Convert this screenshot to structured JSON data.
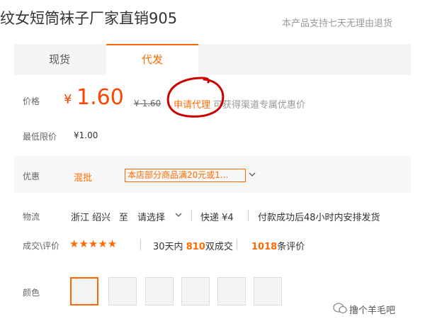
{
  "product_title": "纹女短筒袜子厂家直销905",
  "guarantee": "本产品支持七天无理由退货",
  "tabs": [
    {
      "label": "现货",
      "active": false
    },
    {
      "label": "代发",
      "active": true
    }
  ],
  "price": {
    "label": "价格",
    "currency": "¥",
    "value": "1.60",
    "original": "¥ 1.60",
    "agent_link": "申请代理",
    "agent_desc": "可获得渠道专属优惠价"
  },
  "min_price": {
    "label": "最低限价",
    "value": "¥1.00"
  },
  "promo": {
    "label": "优惠",
    "type": "混批",
    "tag": "本店部分商品满20元或1..."
  },
  "logistics": {
    "label": "物流",
    "origin": "浙江 绍兴",
    "to": "至",
    "dest": "请选择",
    "shipping": "快递 ¥4",
    "delivery": "付款成功后48小时内安排发货"
  },
  "deals": {
    "label": "成交\\评价",
    "stars": "★★★★★",
    "sold_prefix": "30天内",
    "sold_count": "810",
    "sold_suffix": "双成交",
    "review_count": "1018",
    "review_suffix": "条评价"
  },
  "color": {
    "label": "颜色",
    "option_count": 6,
    "selected_index": 0
  },
  "watermark": "撸个羊毛吧",
  "colors": {
    "accent": "#ff6a00",
    "price": "#ff4400",
    "annotation": "#cc0000"
  }
}
